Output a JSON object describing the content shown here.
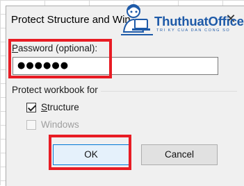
{
  "dialog": {
    "title": "Protect Structure and Win...",
    "close_icon": "close-icon"
  },
  "password": {
    "label_accesskey": "P",
    "label_rest": "assword (optional):",
    "masked_value": "●●●●●●"
  },
  "group": {
    "label": "Protect workbook for",
    "structure": {
      "accesskey": "S",
      "rest": "tructure",
      "checked": true
    },
    "windows": {
      "label": "Windows",
      "checked": false,
      "disabled": true
    }
  },
  "buttons": {
    "ok_label": "OK",
    "cancel_label": "Cancel"
  },
  "logo": {
    "name": "ThuthuatOffice",
    "tagline": "TRI KY CUA DAN CONG SO",
    "icon": "person-at-laptop-icon"
  },
  "colors": {
    "highlight": "#e81c24",
    "ok_border": "#0078d7",
    "logo_blue": "#1e5aa8"
  }
}
